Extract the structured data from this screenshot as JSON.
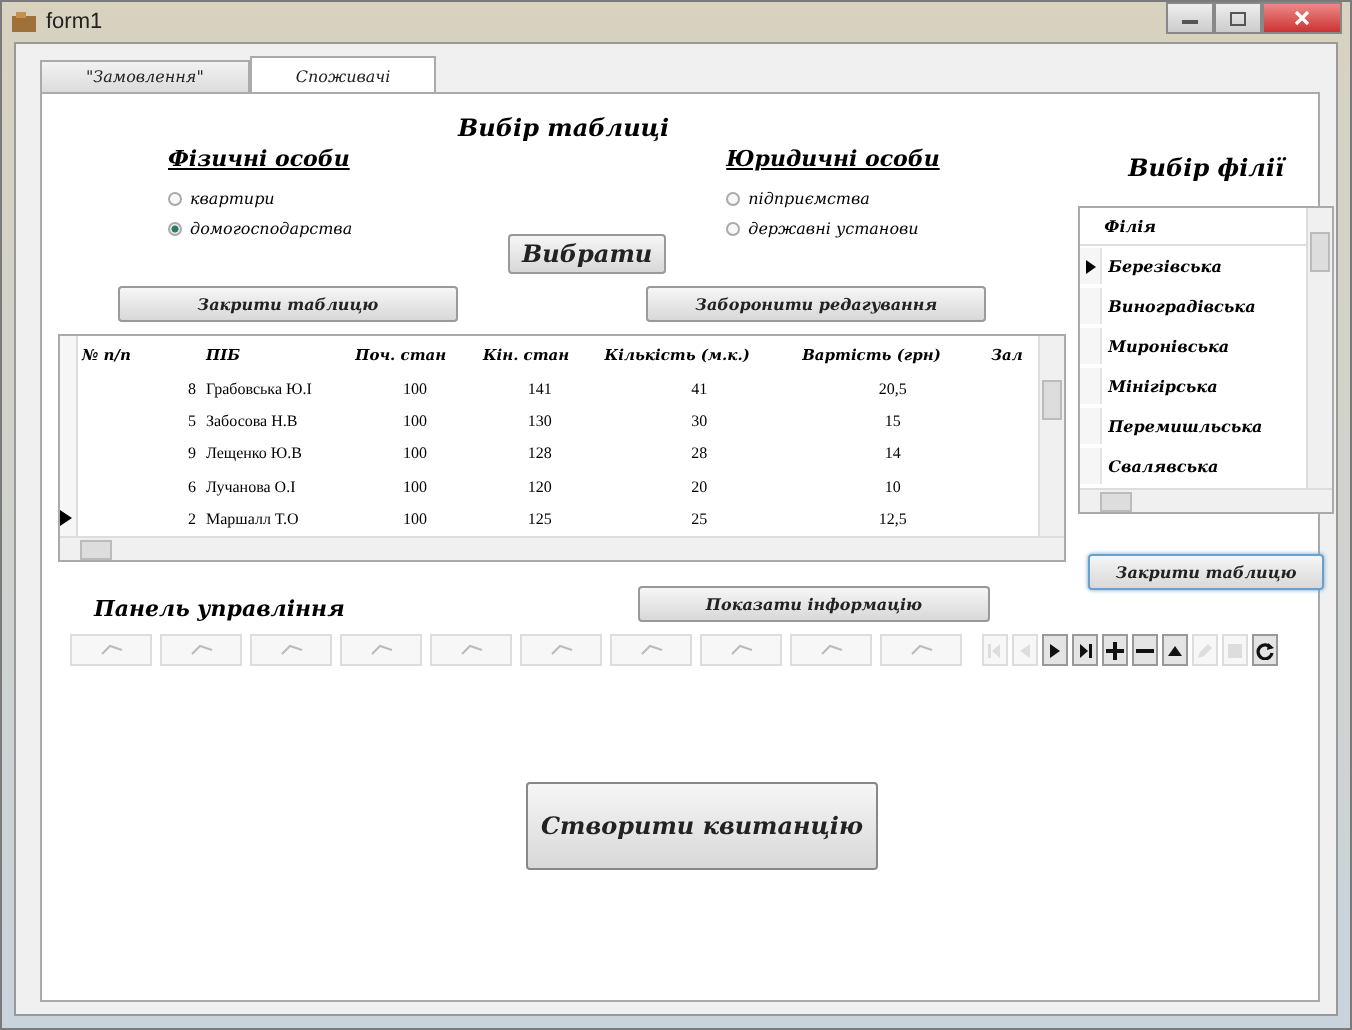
{
  "window": {
    "title": "form1"
  },
  "tabs": [
    {
      "label": "\"Замовлення\"",
      "selected": false
    },
    {
      "label": "Споживачі",
      "selected": true
    }
  ],
  "table_choice": {
    "heading": "Вибір таблиці",
    "groups": [
      {
        "heading": "Фізичні особи",
        "options": [
          {
            "label": "квартири",
            "selected": false
          },
          {
            "label": "домогосподарства",
            "selected": true
          }
        ]
      },
      {
        "heading": "Юридичні особи",
        "options": [
          {
            "label": "підприємства",
            "selected": false
          },
          {
            "label": "державні установи",
            "selected": false
          }
        ]
      }
    ],
    "choose_button": "Вибрати"
  },
  "buttons": {
    "close_table": "Закрити таблицю",
    "forbid_edit": "Заборонити редагування",
    "close_branches": "Закрити таблицю",
    "show_info": "Показати інформацію",
    "create_receipt": "Створити квитанцію"
  },
  "table": {
    "columns": [
      "№ п/п",
      "ПІБ",
      "Поч. стан",
      "Кін. стан",
      "Кількість (м.к.)",
      "Вартість (грн)",
      "Зал"
    ],
    "rows": [
      {
        "selected": false,
        "cells": [
          "8",
          "Грабовська Ю.І",
          "100",
          "141",
          "41",
          "20,5"
        ]
      },
      {
        "selected": false,
        "cells": [
          "5",
          "Забосова Н.В",
          "100",
          "130",
          "30",
          "15"
        ]
      },
      {
        "selected": false,
        "cells": [
          "9",
          "Лещенко Ю.В",
          "100",
          "128",
          "28",
          "14"
        ]
      },
      {
        "selected": false,
        "cells": [
          "6",
          "Лучанова О.І",
          "100",
          "120",
          "20",
          "10"
        ]
      },
      {
        "selected": true,
        "cells": [
          "2",
          "Маршалл Т.О",
          "100",
          "125",
          "25",
          "12,5"
        ]
      }
    ]
  },
  "branches": {
    "heading": "Вибір філії",
    "column": "Філія",
    "rows": [
      {
        "label": "Березівська",
        "selected": true
      },
      {
        "label": "Виноградівська",
        "selected": false
      },
      {
        "label": "Миронівська",
        "selected": false
      },
      {
        "label": "Мінігірська",
        "selected": false
      },
      {
        "label": "Перемишльська",
        "selected": false
      },
      {
        "label": "Свалявська",
        "selected": false
      }
    ]
  },
  "control_panel": {
    "heading": "Панель управління",
    "tools": [
      {
        "kind": "tool",
        "disabled": true
      },
      {
        "kind": "tool",
        "disabled": true
      },
      {
        "kind": "tool",
        "disabled": true
      },
      {
        "kind": "tool",
        "disabled": true
      },
      {
        "kind": "tool",
        "disabled": true
      },
      {
        "kind": "tool",
        "disabled": true
      },
      {
        "kind": "tool",
        "disabled": true
      },
      {
        "kind": "tool",
        "disabled": true
      },
      {
        "kind": "tool",
        "disabled": true
      },
      {
        "kind": "tool",
        "disabled": true
      }
    ],
    "navigator": [
      {
        "kind": "first",
        "disabled": true
      },
      {
        "kind": "prev",
        "disabled": true
      },
      {
        "kind": "next",
        "disabled": false
      },
      {
        "kind": "last",
        "disabled": false
      },
      {
        "kind": "add",
        "disabled": false
      },
      {
        "kind": "delete",
        "disabled": false
      },
      {
        "kind": "up",
        "disabled": false
      },
      {
        "kind": "edit",
        "disabled": true
      },
      {
        "kind": "save",
        "disabled": true
      },
      {
        "kind": "refresh",
        "disabled": false
      }
    ]
  }
}
